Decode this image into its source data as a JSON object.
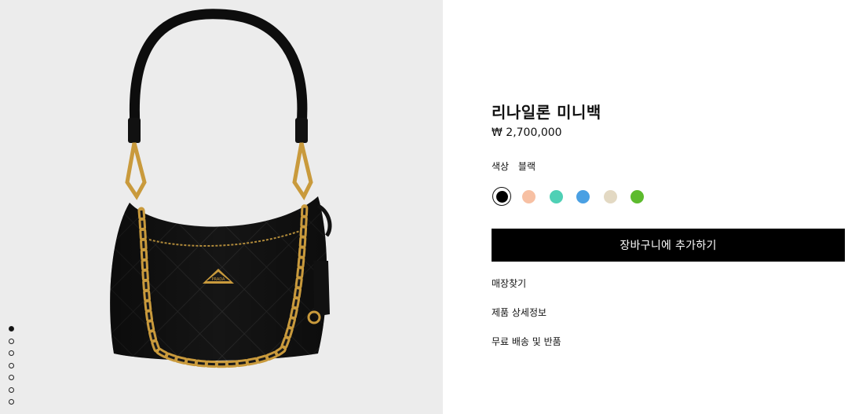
{
  "product": {
    "title": "리나일론 미니백",
    "price": "₩ 2,700,000",
    "color_label": "색상",
    "color_value": "블랙",
    "swatches": [
      {
        "name": "black",
        "color": "#000000",
        "selected": true
      },
      {
        "name": "peach",
        "color": "#f7c0a3",
        "selected": false
      },
      {
        "name": "mint",
        "color": "#4fd0b5",
        "selected": false
      },
      {
        "name": "blue",
        "color": "#4aa0e3",
        "selected": false
      },
      {
        "name": "beige",
        "color": "#e3d9c3",
        "selected": false
      },
      {
        "name": "green",
        "color": "#5dbb2e",
        "selected": false
      }
    ],
    "add_to_cart_label": "장바구니에 추가하기"
  },
  "links": {
    "find_store": "매장찾기",
    "product_details": "제품 상세정보",
    "shipping_returns": "무료 배송 및 반품"
  },
  "gallery": {
    "image_subject": "black quilted nylon mini bag with gold chain",
    "logo_text": "PRADA",
    "slide_count": 8,
    "active_slide": 1
  }
}
